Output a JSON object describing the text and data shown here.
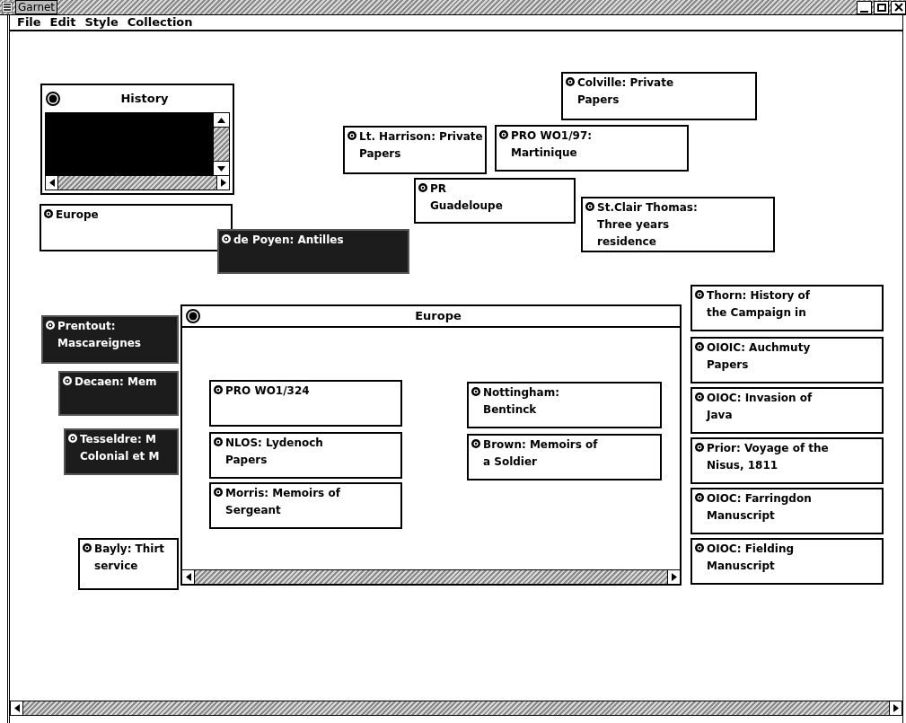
{
  "window": {
    "title": "Garnet"
  },
  "menu": [
    "File",
    "Edit",
    "Style",
    "Collection"
  ],
  "history_panel": {
    "title": "History"
  },
  "notes": [
    {
      "lines": [
        "Colville: Private",
        "Papers"
      ],
      "selected": false
    },
    {
      "lines": [
        "Lt. Harrison: Private",
        "Papers"
      ],
      "selected": false
    },
    {
      "lines": [
        "PR",
        "Guadeloupe"
      ],
      "selected": false
    },
    {
      "lines": [
        "PRO WO1/97:",
        "Martinique"
      ],
      "selected": false
    },
    {
      "lines": [
        "St.Clair Thomas:",
        "Three years",
        "residence"
      ],
      "selected": false
    },
    {
      "lines": [
        "Europe"
      ],
      "selected": false
    },
    {
      "lines": [
        "de Poyen: Antilles"
      ],
      "selected": true
    },
    {
      "lines": [
        "Prentout:",
        "Mascareignes"
      ],
      "selected": true
    },
    {
      "lines": [
        "Decaen: Mem"
      ],
      "selected": true
    },
    {
      "lines": [
        "Tesseldre: M",
        "Colonial et M"
      ],
      "selected": true
    },
    {
      "lines": [
        "Bayly: Thirt",
        "service"
      ],
      "selected": false
    },
    {
      "lines": [
        "Thorn: History of",
        "the Campaign in"
      ],
      "selected": false
    },
    {
      "lines": [
        "OIOIC: Auchmuty",
        "Papers"
      ],
      "selected": false
    },
    {
      "lines": [
        "OIOC: Invasion of",
        "Java"
      ],
      "selected": false
    },
    {
      "lines": [
        "Prior: Voyage of the",
        "Nisus, 1811"
      ],
      "selected": false
    },
    {
      "lines": [
        "OIOC: Farringdon",
        "Manuscript"
      ],
      "selected": false
    },
    {
      "lines": [
        "OIOC: Fielding",
        "Manuscript"
      ],
      "selected": false
    }
  ],
  "europe_window": {
    "title": "Europe",
    "notes": [
      {
        "lines": [
          "PRO WO1/324"
        ],
        "selected": false
      },
      {
        "lines": [
          "NLOS: Lydenoch",
          "Papers"
        ],
        "selected": false
      },
      {
        "lines": [
          "Morris: Memoirs of",
          "Sergeant"
        ],
        "selected": false
      },
      {
        "lines": [
          "Nottingham:",
          "Bentinck"
        ],
        "selected": false
      },
      {
        "lines": [
          "Brown: Memoirs of",
          "a Soldier"
        ],
        "selected": false
      }
    ]
  }
}
